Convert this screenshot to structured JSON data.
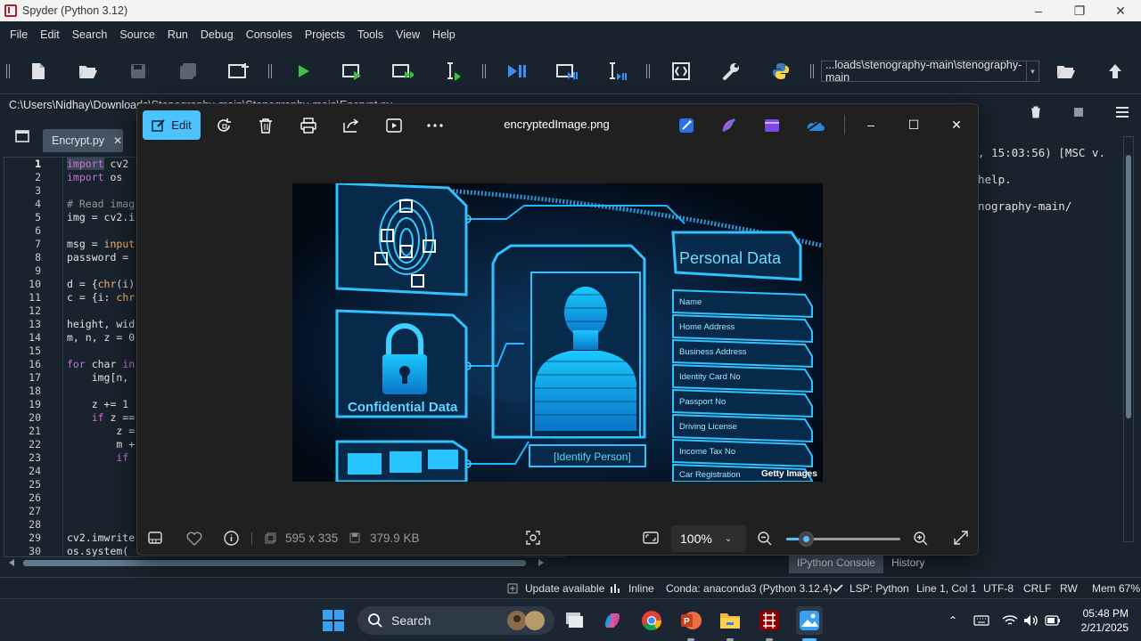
{
  "spyder": {
    "title": "Spyder (Python 3.12)",
    "menu": [
      "File",
      "Edit",
      "Search",
      "Source",
      "Run",
      "Debug",
      "Consoles",
      "Projects",
      "Tools",
      "View",
      "Help"
    ],
    "working_dir": "...loads\\stenography-main\\stenography-main",
    "path": "C:\\Users\\Nidhay\\Downloads\\Stenography-main\\Stenography-main\\Encrypt.py",
    "tab_label": "Encrypt.py",
    "line_numbers": [
      "1",
      "2",
      "3",
      "4",
      "5",
      "6",
      "7",
      "8",
      "9",
      "10",
      "11",
      "12",
      "13",
      "14",
      "15",
      "16",
      "17",
      "18",
      "19",
      "20",
      "21",
      "22",
      "23",
      "24",
      "25",
      "26",
      "27",
      "28",
      "29",
      "30"
    ],
    "console_lines": [
      ", 15:03:56) [MSC v.",
      "",
      "help.",
      "nography-main/"
    ],
    "console_tabs": [
      "IPython Console",
      "History"
    ],
    "status": {
      "update": "Update available",
      "inline": "Inline",
      "conda": "Conda: anaconda3 (Python 3.12.4)",
      "lsp": "LSP: Python",
      "position": "Line 1, Col 1",
      "encoding": "UTF-8",
      "eol": "CRLF",
      "rw": "RW",
      "mem": "Mem 67%"
    }
  },
  "photos": {
    "edit_label": "Edit",
    "filename": "encryptedImage.png",
    "dimensions": "595 x 335",
    "filesize": "379.9 KB",
    "zoom": "100%",
    "zoom_fraction": 0.17,
    "image": {
      "personal_data": "Personal Data",
      "fields": [
        "Name",
        "Home Address",
        "Business Address",
        "Identity Card No",
        "Passport No",
        "Driving License",
        "Income Tax No",
        "Car Registration"
      ],
      "confidential": "Confidential Data",
      "identify": "[Identify Person]",
      "watermark": "Getty Images"
    }
  },
  "taskbar": {
    "search_placeholder": "Search",
    "time": "05:48 PM",
    "date": "2/21/2025"
  },
  "colors": {
    "spyder_bg": "#19232d",
    "accent": "#4cc2ff",
    "photos_bg": "#202020"
  }
}
